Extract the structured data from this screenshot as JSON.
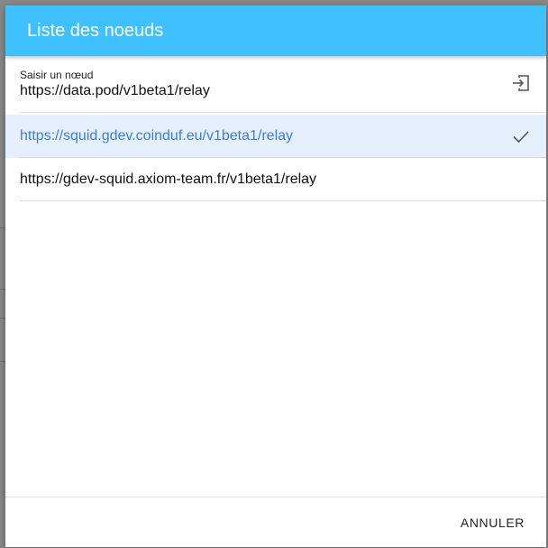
{
  "dialog": {
    "title": "Liste des noeuds"
  },
  "node_input": {
    "label": "Saisir un nœud",
    "value": "https://data.pod/v1beta1/relay",
    "submit_icon": "login-icon"
  },
  "nodes": [
    {
      "url": "https://squid.gdev.coinduf.eu/v1beta1/relay",
      "selected": true,
      "icon": "check-icon"
    },
    {
      "url": "https://gdev-squid.axiom-team.fr/v1beta1/relay",
      "selected": false
    }
  ],
  "footer": {
    "cancel_label": "ANNULER"
  },
  "colors": {
    "toolbar": "#3fc1ff",
    "selected_bg": "#e6effd",
    "selected_text": "#3d7fe0"
  }
}
